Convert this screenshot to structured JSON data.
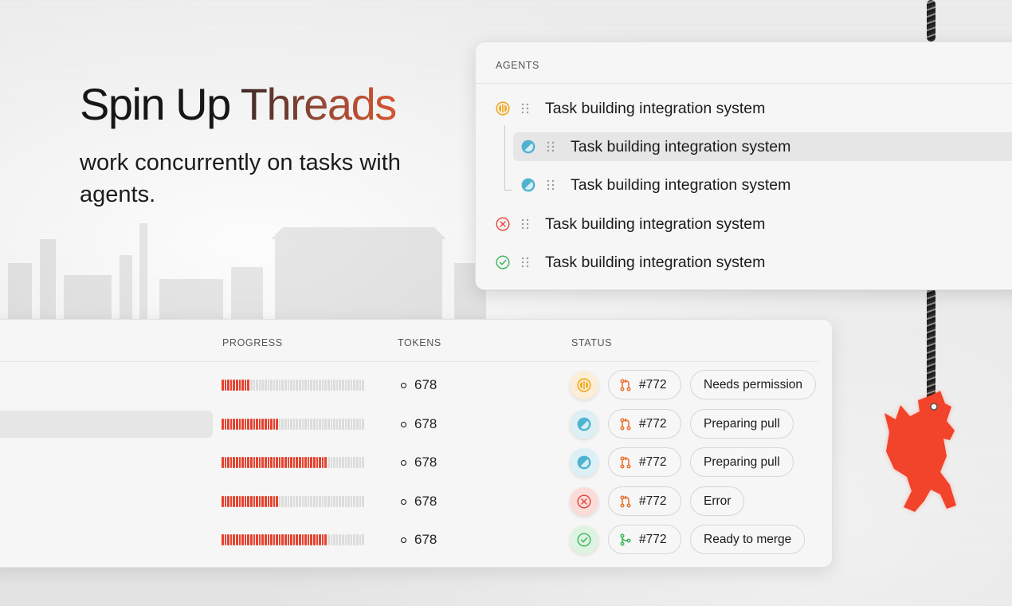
{
  "hero": {
    "title_a": "Spin Up ",
    "title_b": "Threads",
    "subtitle": "work concurrently on tasks with agents."
  },
  "agents": {
    "header": "AGENTS",
    "items": [
      {
        "label": "Task building integration system",
        "status": "permission-icon"
      },
      {
        "label": "Task building integration system",
        "status": "preparing-icon"
      },
      {
        "label": "Task building integration system",
        "status": "preparing-icon"
      },
      {
        "label": "Task building integration system",
        "status": "error-icon"
      },
      {
        "label": "Task building integration system",
        "status": "success-icon"
      }
    ]
  },
  "table": {
    "headers": {
      "progress": "PROGRESS",
      "tokens": "TOKENS",
      "status": "STATUS"
    },
    "rows": [
      {
        "progress": 0.2,
        "tokens": "678",
        "state": "permission",
        "pr": "#772",
        "status": "Needs permission"
      },
      {
        "progress": 0.4,
        "tokens": "678",
        "state": "preparing",
        "pr": "#772",
        "status": "Preparing pull"
      },
      {
        "progress": 0.73,
        "tokens": "678",
        "state": "preparing",
        "pr": "#772",
        "status": "Preparing pull"
      },
      {
        "progress": 0.4,
        "tokens": "678",
        "state": "error",
        "pr": "#772",
        "status": "Error"
      },
      {
        "progress": 0.73,
        "tokens": "678",
        "state": "merge",
        "pr": "#772",
        "status": "Ready to merge"
      }
    ]
  },
  "colors": {
    "accent": "#e5432f",
    "permission": "#f0a820",
    "preparing": "#4fb3cf",
    "error": "#e0443a",
    "success": "#3bb65a",
    "pr_icon": "#ea6f2c"
  }
}
